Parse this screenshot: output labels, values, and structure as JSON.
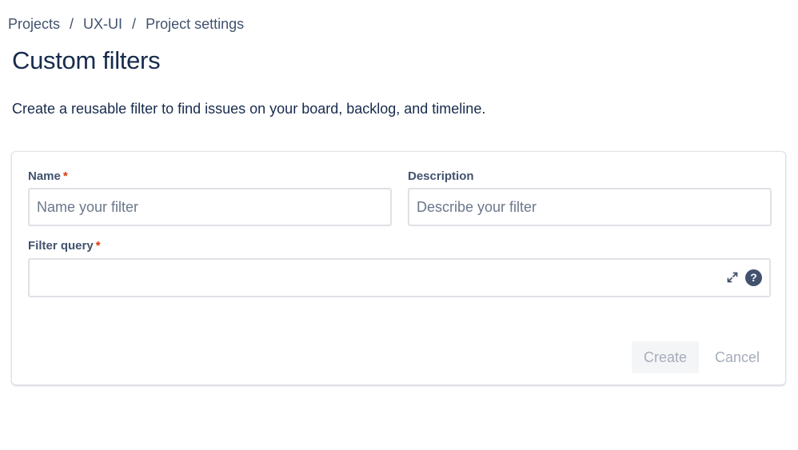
{
  "breadcrumb": {
    "items": [
      "Projects",
      "UX-UI",
      "Project settings"
    ],
    "separator": "/"
  },
  "page": {
    "title": "Custom filters",
    "description": "Create a reusable filter to find issues on your board, backlog, and timeline."
  },
  "form": {
    "name": {
      "label": "Name",
      "required_marker": "*",
      "value": "",
      "placeholder": "Name your filter"
    },
    "description": {
      "label": "Description",
      "value": "",
      "placeholder": "Describe your filter"
    },
    "filter_query": {
      "label": "Filter query",
      "required_marker": "*",
      "value": "",
      "icons": [
        "expand-icon",
        "help-icon"
      ],
      "help_glyph": "?"
    },
    "buttons": {
      "create_label": "Create",
      "cancel_label": "Cancel"
    }
  },
  "colors": {
    "text_primary": "#172b4d",
    "text_secondary": "#42526e",
    "required": "#de350b",
    "border": "#dfe1e6",
    "button_disabled_bg": "#f4f5f7",
    "button_disabled_text": "#a5adba"
  }
}
